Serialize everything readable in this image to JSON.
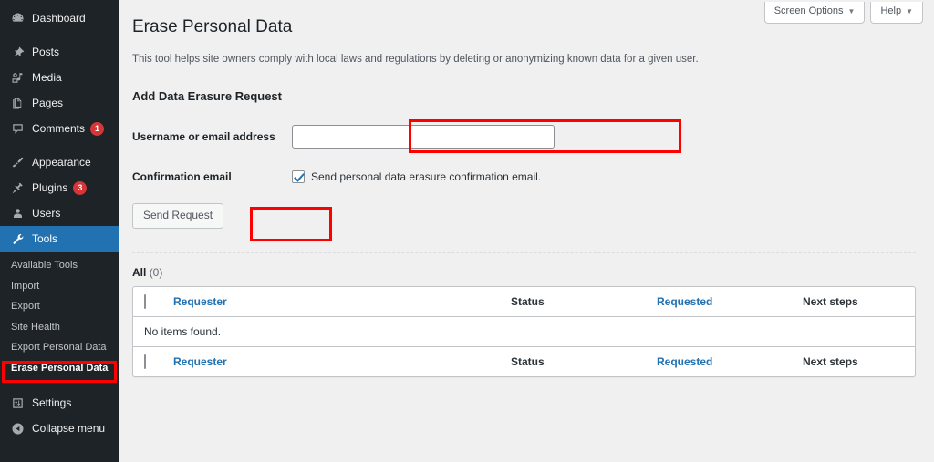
{
  "sidebar": {
    "items": [
      {
        "label": "Dashboard",
        "icon": "dashboard-icon",
        "badge": null
      },
      {
        "label": "Posts",
        "icon": "pin-icon",
        "badge": null
      },
      {
        "label": "Media",
        "icon": "media-icon",
        "badge": null
      },
      {
        "label": "Pages",
        "icon": "pages-icon",
        "badge": null
      },
      {
        "label": "Comments",
        "icon": "comments-icon",
        "badge": "1"
      },
      {
        "label": "Appearance",
        "icon": "appearance-brush-icon",
        "badge": null
      },
      {
        "label": "Plugins",
        "icon": "plugins-icon",
        "badge": "3"
      },
      {
        "label": "Users",
        "icon": "users-icon",
        "badge": null
      },
      {
        "label": "Tools",
        "icon": "tools-wrench-icon",
        "badge": null
      },
      {
        "label": "Settings",
        "icon": "settings-sliders-icon",
        "badge": null
      },
      {
        "label": "Collapse menu",
        "icon": "collapse-arrow-icon",
        "badge": null
      }
    ],
    "active_item": "Tools",
    "submenu": [
      {
        "label": "Available Tools",
        "current": false
      },
      {
        "label": "Import",
        "current": false
      },
      {
        "label": "Export",
        "current": false
      },
      {
        "label": "Site Health",
        "current": false
      },
      {
        "label": "Export Personal Data",
        "current": false
      },
      {
        "label": "Erase Personal Data",
        "current": true
      }
    ],
    "background_color": "#1d2327",
    "active_color": "#2271b1",
    "badge_color": "#d63638"
  },
  "screen_meta": {
    "screen_options_label": "Screen Options",
    "help_label": "Help",
    "caret": "▼"
  },
  "page": {
    "title": "Erase Personal Data",
    "description": "This tool helps site owners comply with local laws and regulations by deleting or anonymizing known data for a given user.",
    "section_title": "Add Data Erasure Request"
  },
  "form": {
    "username_label": "Username or email address",
    "username_value": "",
    "username_placeholder": "",
    "confirmation_label": "Confirmation email",
    "confirmation_checkbox_label": "Send personal data erasure confirmation email.",
    "confirmation_checked": true,
    "submit_label": "Send Request"
  },
  "list": {
    "filter_all_label": "All",
    "filter_all_count": "(0)",
    "columns": [
      {
        "label": "Requester",
        "link": true
      },
      {
        "label": "Status",
        "link": false
      },
      {
        "label": "Requested",
        "link": true
      },
      {
        "label": "Next steps",
        "link": false
      }
    ],
    "empty_message": "No items found."
  },
  "annotations": {
    "highlight_color": "#ff0000",
    "targets": [
      "username-input",
      "send-request-button",
      "sidebar-item-erase-personal-data"
    ]
  }
}
